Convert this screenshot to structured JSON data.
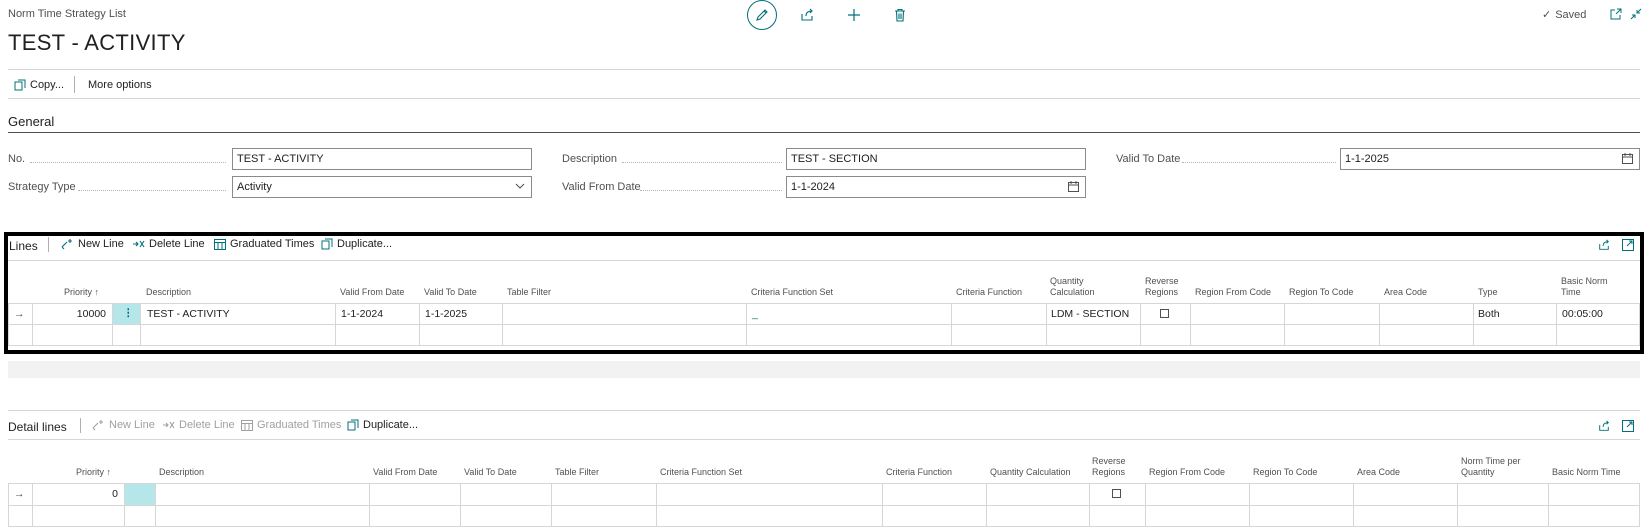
{
  "header": {
    "breadcrumb": "Norm Time Strategy List",
    "title": "TEST - ACTIVITY",
    "saved_label": "Saved",
    "icons": [
      "pencil-edit-icon",
      "share-icon",
      "plus-icon",
      "trash-icon",
      "open-new-window-icon",
      "collapse-icon"
    ]
  },
  "actions": {
    "copy_label": "Copy...",
    "more_options_label": "More options"
  },
  "general": {
    "section_title": "General",
    "no_label": "No.",
    "no_value": "TEST - ACTIVITY",
    "strategy_type_label": "Strategy Type",
    "strategy_type_value": "Activity",
    "description_label": "Description",
    "description_value": "TEST - SECTION",
    "valid_from_label": "Valid From Date",
    "valid_from_value": "1-1-2024",
    "valid_to_label": "Valid To Date",
    "valid_to_value": "1-1-2025"
  },
  "lines": {
    "title": "Lines",
    "actions": {
      "new_line": "New Line",
      "delete_line": "Delete Line",
      "graduated_times": "Graduated Times",
      "duplicate": "Duplicate..."
    },
    "columns": {
      "priority": "Priority",
      "sort_indicator": "↑",
      "description": "Description",
      "valid_from": "Valid From Date",
      "valid_to": "Valid To Date",
      "table_filter": "Table Filter",
      "criteria_function_set": "Criteria Function Set",
      "criteria_function": "Criteria Function",
      "quantity_calculation": "Quantity Calculation",
      "reverse_regions": "Reverse Regions",
      "region_from": "Region From Code",
      "region_to": "Region To Code",
      "area_code": "Area Code",
      "type": "Type",
      "basic_norm_time": "Basic Norm Time"
    },
    "row": {
      "priority": "10000",
      "description": "TEST - ACTIVITY",
      "valid_from": "1-1-2024",
      "valid_to": "1-1-2025",
      "table_filter": "",
      "criteria_function_set": "_",
      "criteria_function": "",
      "quantity_calculation": "LDM - SECTION",
      "reverse_regions": false,
      "region_from": "",
      "region_to": "",
      "area_code": "",
      "type": "Both",
      "basic_norm_time": "00:05:00"
    }
  },
  "detail_lines": {
    "title": "Detail lines",
    "actions": {
      "new_line": "New Line",
      "delete_line": "Delete Line",
      "graduated_times": "Graduated Times",
      "duplicate": "Duplicate..."
    },
    "columns": {
      "priority": "Priority",
      "sort_indicator": "↑",
      "description": "Description",
      "valid_from": "Valid From Date",
      "valid_to": "Valid To Date",
      "table_filter": "Table Filter",
      "criteria_function_set": "Criteria Function Set",
      "criteria_function": "Criteria Function",
      "quantity_calculation": "Quantity Calculation",
      "reverse_regions": "Reverse Regions",
      "region_from": "Region From Code",
      "region_to": "Region To Code",
      "area_code": "Area Code",
      "norm_time_per_quantity": "Norm Time per Quantity",
      "basic_norm_time": "Basic Norm Time"
    },
    "row": {
      "priority": "0",
      "reverse_regions": false
    }
  },
  "colors": {
    "accent": "#00707a",
    "selected_cell": "#b4e6ea",
    "highlight_border": "#000000"
  }
}
